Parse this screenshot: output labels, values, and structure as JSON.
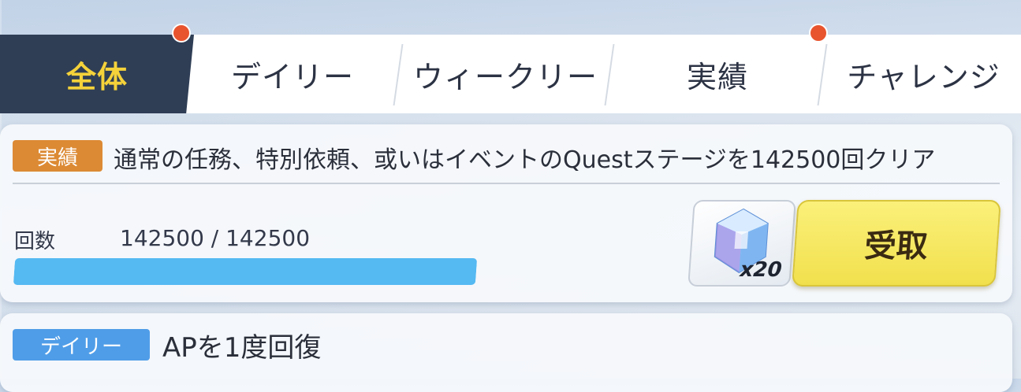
{
  "tabs": [
    {
      "label": "全体",
      "active": true,
      "has_notification": true
    },
    {
      "label": "デイリー",
      "active": false,
      "has_notification": false
    },
    {
      "label": "ウィークリー",
      "active": false,
      "has_notification": false
    },
    {
      "label": "実績",
      "active": false,
      "has_notification": true
    },
    {
      "label": "チャレンジ",
      "active": false,
      "has_notification": false
    }
  ],
  "missions": [
    {
      "category": "実績",
      "description": "通常の任務、特別依頼、或いはイベントのQuestステージを142500回クリア",
      "progress_label": "回数",
      "progress_text": "142500 / 142500",
      "progress_fraction": 1.0,
      "reward": {
        "icon": "blue-crystal-icon",
        "count": "x20"
      },
      "claim_label": "受取"
    },
    {
      "category": "デイリー",
      "description": "APを1度回復"
    }
  ],
  "colors": {
    "active_tab_bg": "#2f3e55",
    "active_tab_text": "#f5d23a",
    "notification_dot": "#e8542e",
    "achievement_badge": "#dc8a34",
    "daily_badge": "#4f9de8",
    "progress_fill": "#55b9f2",
    "claim_button": "#f1e04d"
  }
}
